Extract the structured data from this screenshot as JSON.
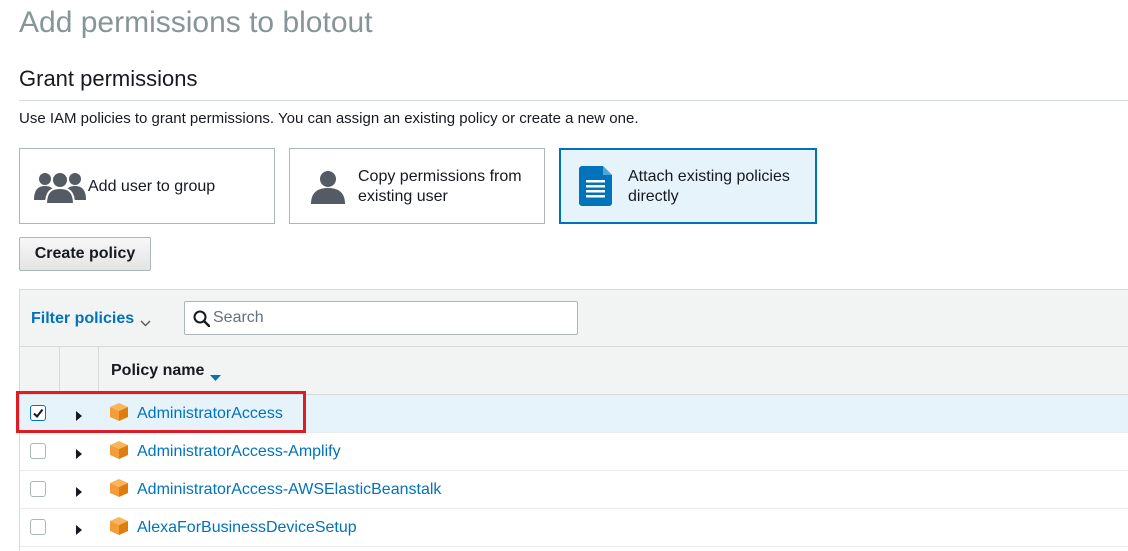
{
  "page_title": "Add permissions to blotout",
  "section_title": "Grant permissions",
  "description": "Use IAM policies to grant permissions. You can assign an existing policy or create a new one.",
  "options": [
    {
      "id": "add_group",
      "label": "Add user to group",
      "icon": "users-group-icon",
      "selected": false
    },
    {
      "id": "copy_perms",
      "label_line1": "Copy permissions from",
      "label_line2": "existing user",
      "icon": "user-icon",
      "selected": false
    },
    {
      "id": "attach",
      "label_line1": "Attach existing policies",
      "label_line2": "directly",
      "icon": "document-icon",
      "selected": true
    }
  ],
  "create_policy_label": "Create policy",
  "filter": {
    "label": "Filter policies",
    "search_placeholder": "Search",
    "search_value": ""
  },
  "table": {
    "column_header": "Policy name",
    "rows": [
      {
        "name": "AdministratorAccess",
        "checked": true
      },
      {
        "name": "AdministratorAccess-Amplify",
        "checked": false
      },
      {
        "name": "AdministratorAccess-AWSElasticBeanstalk",
        "checked": false
      },
      {
        "name": "AlexaForBusinessDeviceSetup",
        "checked": false
      }
    ]
  },
  "colors": {
    "accent": "#0073bb",
    "policy_icon": "#f29d38",
    "highlight": "#e01b24",
    "selected_bg": "#e6f3fb"
  }
}
